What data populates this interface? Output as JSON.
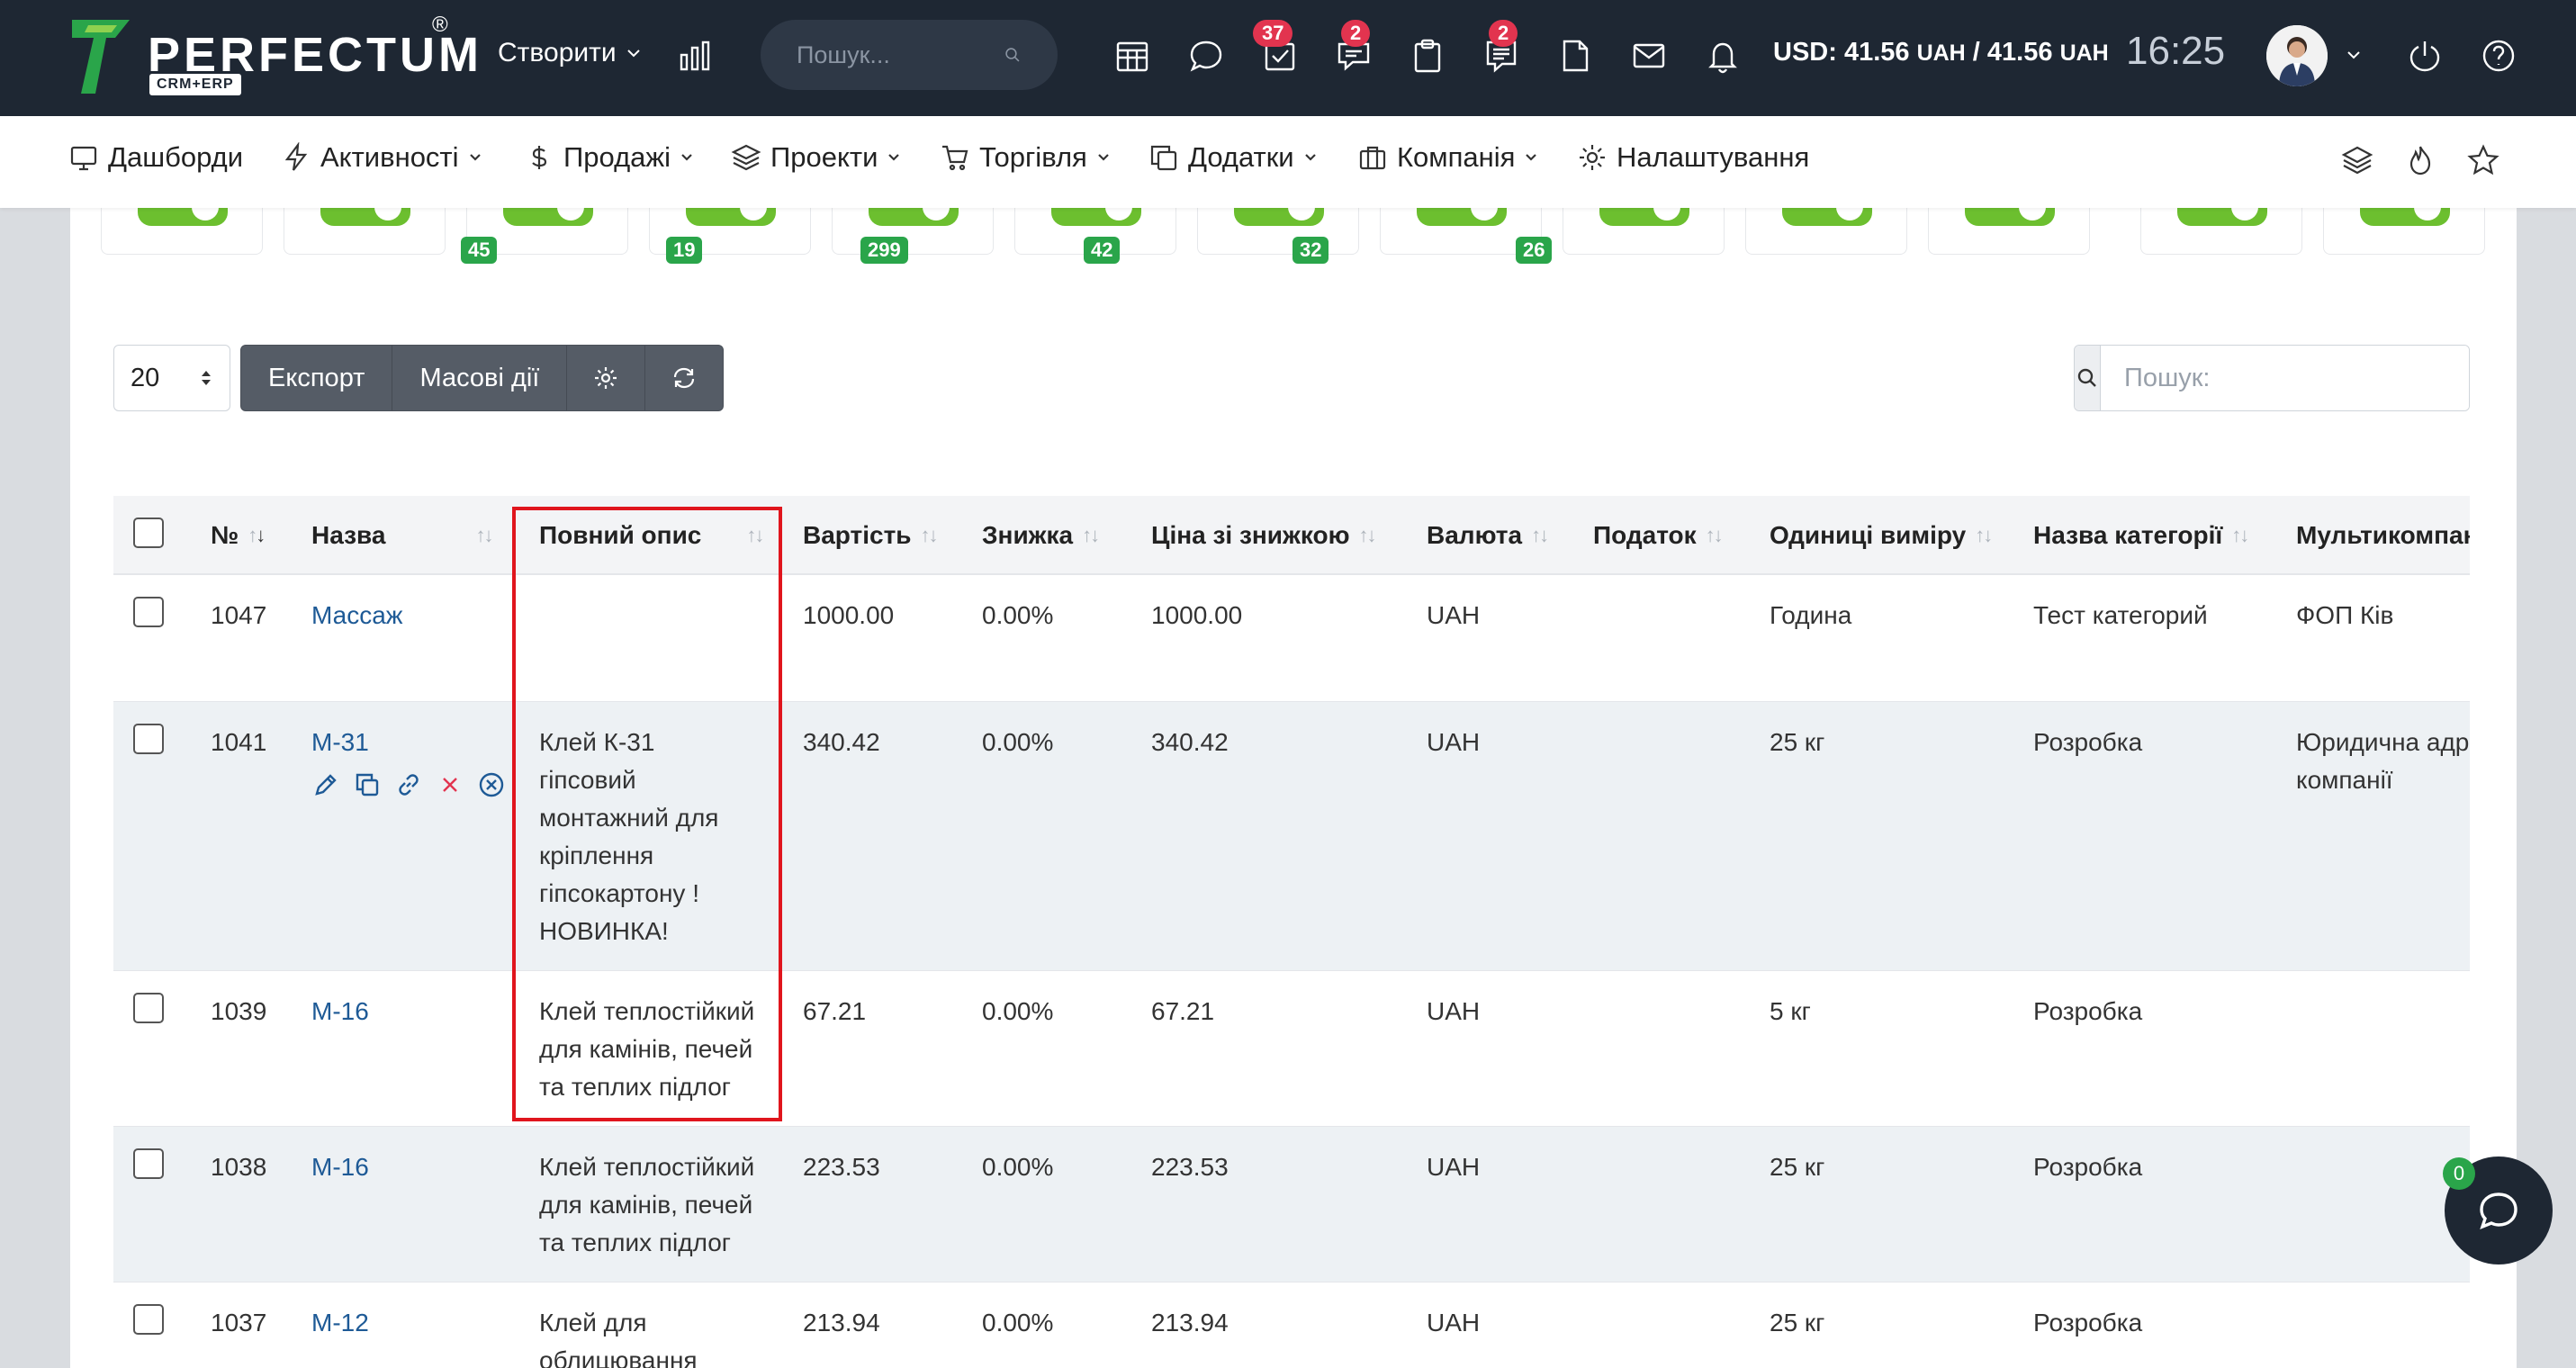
{
  "brand": {
    "name": "PERFECTUM",
    "registered": "®",
    "sub": "CRM+ERP"
  },
  "topbar": {
    "create_label": "Створити",
    "search_placeholder": "Пошук...",
    "badges": {
      "tasks": "37",
      "messages": "2",
      "notes": "2"
    },
    "currency": "USD: 41.56",
    "currency_unit1": "UAH",
    "currency_sep": " / 41.56 ",
    "currency_unit2": "UAH",
    "clock": "16:25"
  },
  "nav": [
    {
      "label": "Дашборди",
      "badge": ""
    },
    {
      "label": "Активності",
      "badge": "45"
    },
    {
      "label": "Продажі",
      "badge": "19"
    },
    {
      "label": "Проекти",
      "badge": "299"
    },
    {
      "label": "Торгівля",
      "badge": "42"
    },
    {
      "label": "Додатки",
      "badge": "32"
    },
    {
      "label": "Компанія",
      "badge": "26"
    },
    {
      "label": "Налаштування",
      "badge": ""
    }
  ],
  "controls": {
    "page_length": "20",
    "export_label": "Експорт",
    "bulk_label": "Масові дії",
    "search_placeholder": "Пошук:"
  },
  "table": {
    "headers": [
      "№",
      "Назва",
      "Повний опис",
      "Вартість",
      "Знижка",
      "Ціна зі знижкою",
      "Валюта",
      "Податок",
      "Одиниці виміру",
      "Назва категорії",
      "Мультикомпан"
    ],
    "rows": [
      {
        "id": "1047",
        "name": "Массаж",
        "desc": [],
        "price": "1000.00",
        "discount": "0.00%",
        "discounted": "1000.00",
        "currency": "UAH",
        "tax": "",
        "unit": "Година",
        "category": "Тест категорий",
        "company": [
          "ФОП Ків"
        ]
      },
      {
        "id": "1041",
        "name": "М-31",
        "desc": [
          "Клей К-31",
          "гіпсовий",
          "монтажний для",
          "кріплення",
          "гіпсокартону !",
          "НОВИНКА!"
        ],
        "price": "340.42",
        "discount": "0.00%",
        "discounted": "340.42",
        "currency": "UAH",
        "tax": "",
        "unit": "25 кг",
        "category": "Розробка",
        "company": [
          "Юридична адр",
          "компанії"
        ]
      },
      {
        "id": "1039",
        "name": "М-16",
        "desc": [
          "Клей теплостійкий",
          "для камінів, печей",
          "та теплих підлог"
        ],
        "price": "67.21",
        "discount": "0.00%",
        "discounted": "67.21",
        "currency": "UAH",
        "tax": "",
        "unit": "5 кг",
        "category": "Розробка",
        "company": []
      },
      {
        "id": "1038",
        "name": "М-16",
        "desc": [
          "Клей теплостійкий",
          "для камінів, печей",
          "та теплих підлог"
        ],
        "price": "223.53",
        "discount": "0.00%",
        "discounted": "223.53",
        "currency": "UAH",
        "tax": "",
        "unit": "25 кг",
        "category": "Розробка",
        "company": []
      },
      {
        "id": "1037",
        "name": "М-12",
        "desc": [
          "Клей для",
          "облицювання"
        ],
        "price": "213.94",
        "discount": "0.00%",
        "discounted": "213.94",
        "currency": "UAH",
        "tax": "",
        "unit": "25 кг",
        "category": "Розробка",
        "company": []
      }
    ]
  },
  "chat": {
    "badge": "0"
  },
  "colors": {
    "topbar": "#1e2733",
    "badge_red": "#e2344f",
    "badge_green": "#2aa54a",
    "toggle_green": "#6cbf2f",
    "highlight": "#e0151d",
    "link": "#1e5a96"
  }
}
